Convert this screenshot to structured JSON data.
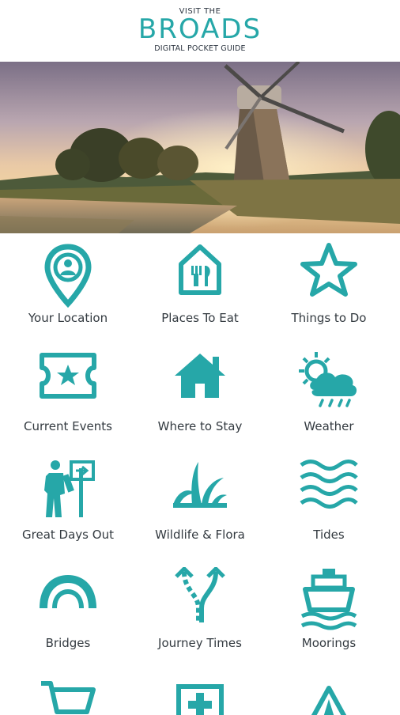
{
  "header": {
    "top": "VISIT THE",
    "main": "BROADS",
    "sub": "DIGITAL POCKET GUIDE"
  },
  "accent": "#26a7a8",
  "menu": [
    {
      "label": "Your Location",
      "icon": "location-pin-icon"
    },
    {
      "label": "Places To Eat",
      "icon": "cutlery-house-icon"
    },
    {
      "label": "Things to Do",
      "icon": "star-icon"
    },
    {
      "label": "Current Events",
      "icon": "ticket-icon"
    },
    {
      "label": "Where to Stay",
      "icon": "house-icon"
    },
    {
      "label": "Weather",
      "icon": "weather-icon"
    },
    {
      "label": "Great Days Out",
      "icon": "walker-signpost-icon"
    },
    {
      "label": "Wildlife & Flora",
      "icon": "reeds-icon"
    },
    {
      "label": "Tides",
      "icon": "waves-icon"
    },
    {
      "label": "Bridges",
      "icon": "bridge-icon"
    },
    {
      "label": "Journey Times",
      "icon": "route-icon"
    },
    {
      "label": "Moorings",
      "icon": "boat-icon"
    },
    {
      "label": "",
      "icon": "cart-icon"
    },
    {
      "label": "",
      "icon": "first-aid-icon"
    },
    {
      "label": "",
      "icon": "tent-icon"
    }
  ]
}
